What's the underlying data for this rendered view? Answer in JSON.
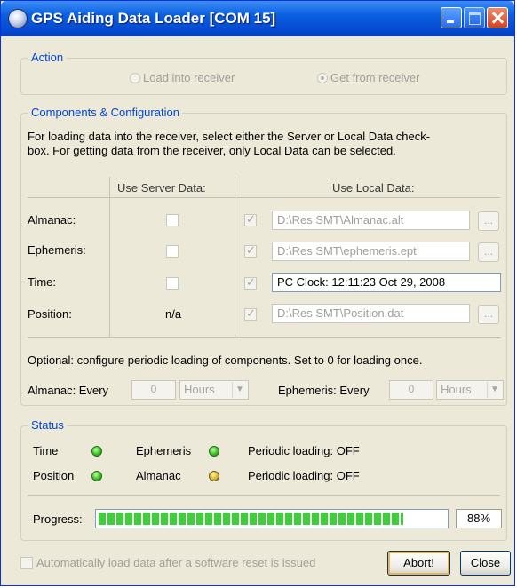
{
  "window": {
    "title": "GPS Aiding Data Loader [COM 15]"
  },
  "action": {
    "legend": "Action",
    "load_label": "Load into receiver",
    "get_label": "Get from receiver",
    "selected": "get"
  },
  "components": {
    "legend": "Components & Configuration",
    "instructions": [
      "For loading data into the receiver, select either the Server or Local Data check-",
      "box. For getting data from the receiver, only Local Data can be selected."
    ],
    "server_header": "Use Server Data:",
    "local_header": "Use Local Data:",
    "rows": [
      {
        "label": "Almanac:",
        "server": "checkbox",
        "local_checked": true,
        "path": "D:\\Res SMT\\Almanac.alt",
        "browse": "..."
      },
      {
        "label": "Ephemeris:",
        "server": "checkbox",
        "local_checked": true,
        "path": "D:\\Res SMT\\ephemeris.ept",
        "browse": "..."
      },
      {
        "label": "Time:",
        "server": "checkbox",
        "local_checked": true,
        "path": "PC Clock: 12:11:23  Oct 29, 2008"
      },
      {
        "label": "Position:",
        "server": "n/a",
        "local_checked": true,
        "path": "D:\\Res SMT\\Position.dat",
        "browse": "..."
      }
    ],
    "optional_text": "Optional: configure periodic loading of components. Set to 0 for loading once.",
    "almanac_every_label": "Almanac: Every",
    "almanac_value": "0",
    "almanac_unit": "Hours",
    "ephemeris_every_label": "Ephemeris: Every",
    "ephemeris_value": "0",
    "ephemeris_unit": "Hours"
  },
  "status": {
    "legend": "Status",
    "indicators": {
      "time": {
        "label": "Time",
        "color": "#38c020"
      },
      "position": {
        "label": "Position",
        "color": "#38c020"
      },
      "ephemeris": {
        "label": "Ephemeris",
        "color": "#38c020"
      },
      "almanac": {
        "label": "Almanac",
        "color": "#d7b830"
      }
    },
    "periodic_1": "Periodic loading: OFF",
    "periodic_2": "Periodic loading: OFF",
    "progress_label": "Progress:",
    "progress_percent": 88,
    "progress_text": "88%"
  },
  "footer": {
    "auto_load_label": "Automatically load data after a software reset is issued",
    "abort_label": "Abort!",
    "close_label": "Close"
  }
}
